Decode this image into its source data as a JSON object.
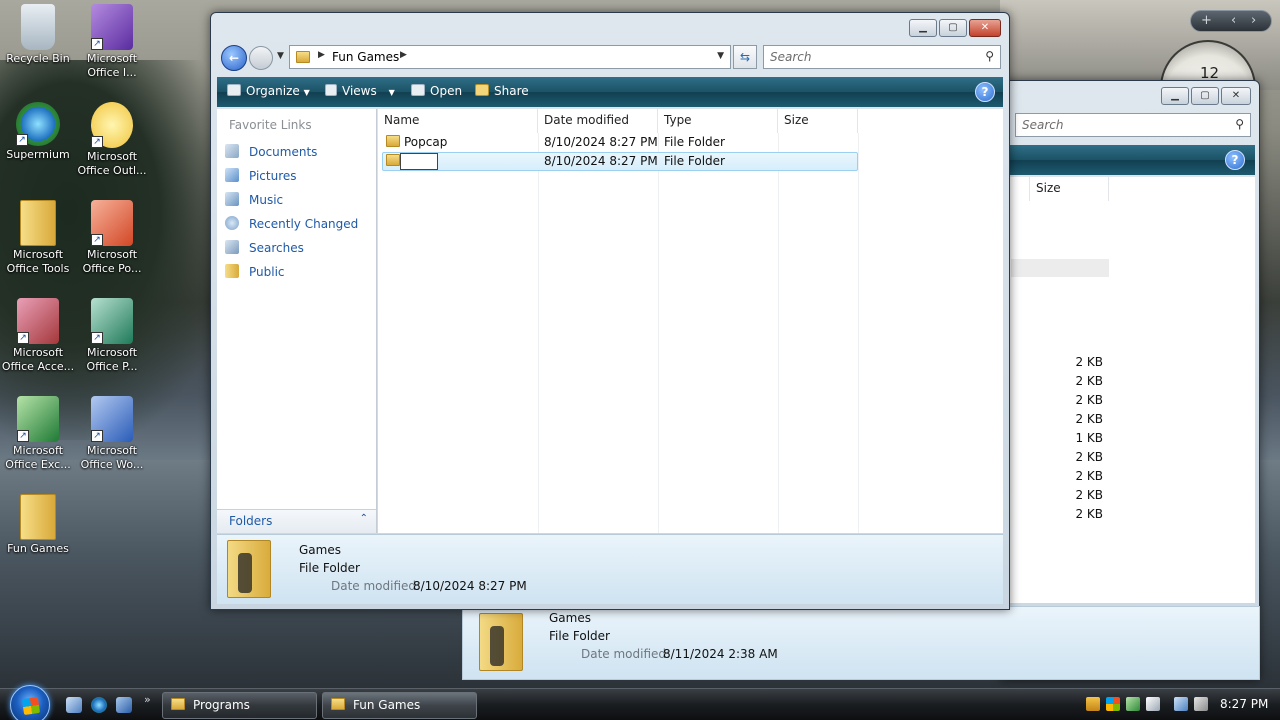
{
  "desktop": {
    "icons": [
      {
        "label": "Recycle Bin"
      },
      {
        "label": "Microsoft Office I..."
      },
      {
        "label": "Supermium"
      },
      {
        "label": "Microsoft Office Outl..."
      },
      {
        "label": "Microsoft Office Tools"
      },
      {
        "label": "Microsoft Office Po..."
      },
      {
        "label": "Microsoft Office Acce..."
      },
      {
        "label": "Microsoft Office P..."
      },
      {
        "label": "Microsoft Office Exc..."
      },
      {
        "label": "Microsoft Office Wo..."
      },
      {
        "label": "Fun Games"
      }
    ],
    "clock_gadget_numeral": "12"
  },
  "back_window": {
    "search_placeholder": "Search",
    "col_size": "Size",
    "sizes": [
      "2 KB",
      "2 KB",
      "2 KB",
      "2 KB",
      "1 KB",
      "2 KB",
      "2 KB",
      "2 KB",
      "2 KB"
    ],
    "details": {
      "name": "Games",
      "type": "File Folder",
      "date_label": "Date modified:",
      "date_value": "8/11/2024 2:38 AM"
    }
  },
  "window": {
    "breadcrumb": "Fun Games",
    "search_placeholder": "Search",
    "toolbar": {
      "organize": "Organize",
      "views": "Views",
      "open": "Open",
      "share": "Share",
      "help": "?"
    },
    "nav": {
      "header": "Favorite Links",
      "links": [
        "Documents",
        "Pictures",
        "Music",
        "Recently Changed",
        "Searches",
        "Public"
      ],
      "folders": "Folders"
    },
    "columns": {
      "name": "Name",
      "date": "Date modified",
      "type": "Type",
      "size": "Size"
    },
    "rows": [
      {
        "name": "Popcap",
        "date": "8/10/2024 8:27 PM",
        "type": "File Folder"
      },
      {
        "name": "",
        "date": "8/10/2024 8:27 PM",
        "type": "File Folder"
      }
    ],
    "details": {
      "name": "Games",
      "type": "File Folder",
      "date_label": "Date modified:",
      "date_value": "8/10/2024 8:27 PM"
    }
  },
  "taskbar": {
    "buttons": [
      "Programs",
      "Fun Games"
    ],
    "clock": "8:27 PM"
  }
}
